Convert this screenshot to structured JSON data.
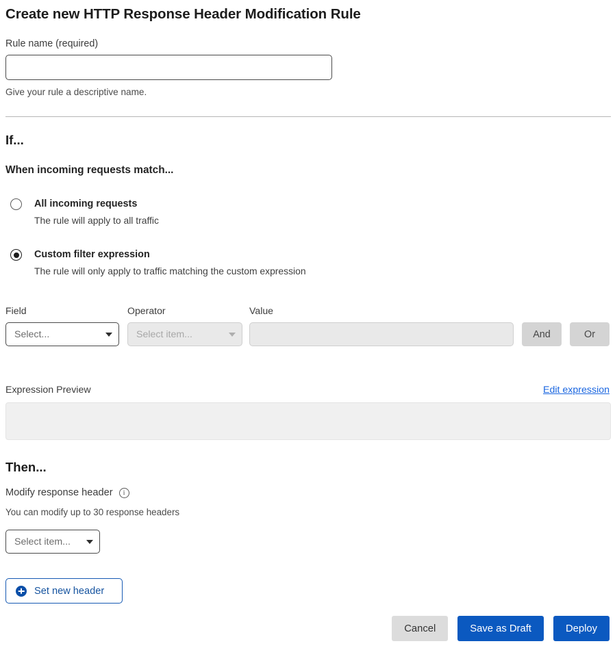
{
  "header": {
    "title": "Create new HTTP Response Header Modification Rule"
  },
  "rule_name": {
    "label": "Rule name (required)",
    "value": "",
    "placeholder": "",
    "help": "Give your rule a descriptive name."
  },
  "if_section": {
    "heading": "If...",
    "sub_heading": "When incoming requests match...",
    "options": [
      {
        "title": "All incoming requests",
        "description": "The rule will apply to all traffic",
        "selected": false
      },
      {
        "title": "Custom filter expression",
        "description": "The rule will only apply to traffic matching the custom expression",
        "selected": true
      }
    ],
    "builder": {
      "field_label": "Field",
      "field_value": "Select...",
      "operator_label": "Operator",
      "operator_value": "Select item...",
      "value_label": "Value",
      "value_value": "",
      "value_placeholder": "",
      "and_label": "And",
      "or_label": "Or"
    },
    "preview": {
      "label": "Expression Preview",
      "edit_link": "Edit expression",
      "text": ""
    }
  },
  "then_section": {
    "heading": "Then...",
    "modify_label": "Modify response header",
    "info_icon_glyph": "i",
    "help": "You can modify up to 30 response headers",
    "select_value": "Select item...",
    "set_new_header_label": "Set new header"
  },
  "actions": {
    "cancel": "Cancel",
    "save_draft": "Save as Draft",
    "deploy": "Deploy"
  },
  "colors": {
    "primary_blue": "#0b59c0",
    "link_blue": "#1a66e0",
    "outline_blue": "#15539f",
    "disabled_grey": "#e9e9e9",
    "cancel_grey": "#dcdcdc"
  }
}
